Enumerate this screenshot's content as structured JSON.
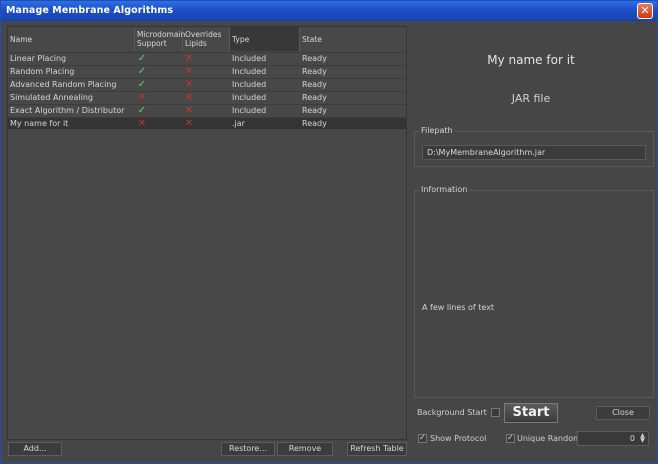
{
  "window": {
    "title": "Manage Membrane Algorithms",
    "close_glyph": "✕"
  },
  "table": {
    "columns": [
      "Name",
      "Microdomain\nSupport",
      "Overrides\nLipids",
      "Type",
      "State"
    ],
    "rows": [
      {
        "name": "Linear Placing",
        "microdomain": true,
        "lipids": false,
        "type": "Included",
        "state": "Ready"
      },
      {
        "name": "Random Placing",
        "microdomain": true,
        "lipids": false,
        "type": "Included",
        "state": "Ready"
      },
      {
        "name": "Advanced Random Placing",
        "microdomain": true,
        "lipids": false,
        "type": "Included",
        "state": "Ready"
      },
      {
        "name": "Simulated Annealing",
        "microdomain": false,
        "lipids": false,
        "type": "Included",
        "state": "Ready"
      },
      {
        "name": "Exact Algorithm / Distributor",
        "microdomain": true,
        "lipids": false,
        "type": "Included",
        "state": "Ready"
      },
      {
        "name": "My name for it",
        "microdomain": false,
        "lipids": false,
        "type": ".jar",
        "state": "Ready",
        "selected": true
      }
    ],
    "yes_glyph": "✓",
    "no_glyph": "✕"
  },
  "buttons": {
    "add": "Add...",
    "restore": "Restore...",
    "remove": "Remove",
    "refresh": "Refresh Table",
    "start": "Start",
    "close": "Close"
  },
  "details": {
    "name": "My name for it",
    "kind": "JAR file",
    "filepath_label": "Filepath",
    "filepath": "D:\\MyMembraneAlgorithm.jar",
    "information_label": "Information",
    "information": "A few lines of text"
  },
  "options": {
    "background_start": "Background Start",
    "show_protocol": "Show Protocol",
    "unique_random": "Unique Random",
    "seed": "0"
  },
  "colors": {
    "accent": "#1d4fc4",
    "check": "#5fd35f",
    "cross": "#c8342a"
  }
}
